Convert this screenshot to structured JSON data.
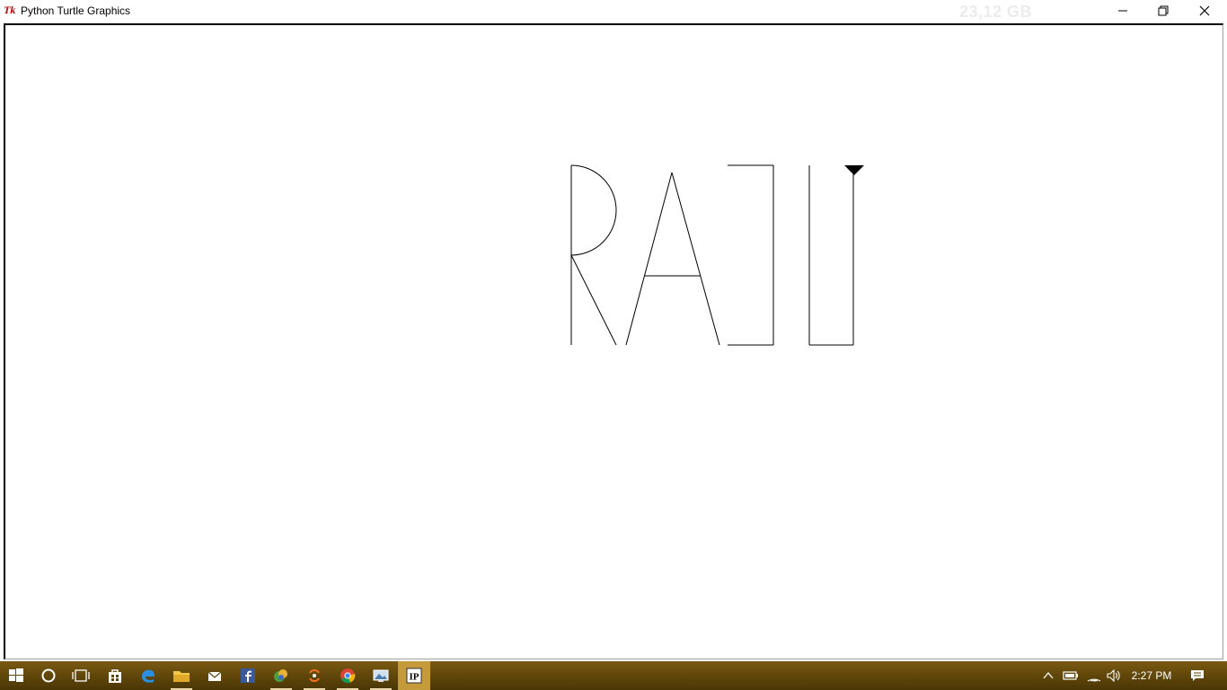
{
  "window": {
    "logo_text": "Tk",
    "title": "Python Turtle Graphics",
    "faint_overlay": "23,12 GB",
    "controls": {
      "minimize": "minimize-icon",
      "restore": "restore-icon",
      "close": "close-icon"
    }
  },
  "drawing": {
    "letters": [
      "R",
      "A",
      "J",
      "U"
    ],
    "stroke_color": "#000000",
    "background_color": "#ffffff"
  },
  "taskbar": {
    "icons": [
      "windows-start-icon",
      "cortana-search-icon",
      "task-view-icon",
      "store-icon",
      "edge-icon",
      "file-explorer-icon",
      "mail-icon",
      "facebook-icon",
      "app-icon",
      "app-icon-2",
      "chrome-icon",
      "photos-icon",
      "python-idle-icon"
    ],
    "active_label": "IP",
    "tray": [
      "chevron-up-icon",
      "battery-icon",
      "wifi-icon",
      "volume-icon"
    ],
    "time": "2:27 PM",
    "notification": "notification-icon"
  }
}
